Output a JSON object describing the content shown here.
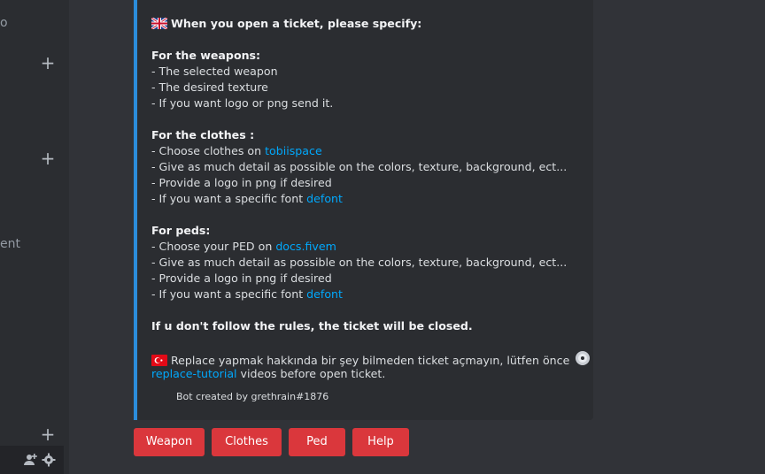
{
  "sidebar": {
    "top_fragment": "o",
    "mid_fragment": "ent"
  },
  "embed": {
    "intro": "When you open a ticket, please specify:",
    "weapons": {
      "heading": "For the weapons:",
      "lines": [
        "- The selected weapon",
        "- The desired texture",
        "- If you want logo or png send it."
      ]
    },
    "clothes": {
      "heading": "For the clothes :",
      "line1_prefix": "- Choose clothes on ",
      "line1_link": "tobiispace",
      "line2": "- Give as much detail as possible on the colors, texture, background, ect...",
      "line3": "- Provide a logo in png if desired",
      "line4_prefix": "- If you want a specific font ",
      "line4_link": "defont"
    },
    "peds": {
      "heading": "For peds:",
      "line1_prefix": "- Choose your PED on ",
      "line1_link": "docs.fivem",
      "line2": "- Give as much detail as possible on the colors, texture, background, ect...",
      "line3": "- Provide a logo in png if desired",
      "line4_prefix": "- If you want a specific font ",
      "line4_link": "defont"
    },
    "warning": "If u don't follow the rules, the ticket will be closed.",
    "turkish_text": "Replace yapmak hakkında bir şey bilmeden ticket açmayın, lütfen önce",
    "turkish_link": "replace-tutorial",
    "turkish_suffix": " videos before open ticket.",
    "footer": "Bot created by grethrain#1876"
  },
  "buttons": [
    {
      "label": "Weapon"
    },
    {
      "label": "Clothes"
    },
    {
      "label": "Ped"
    },
    {
      "label": "Help"
    }
  ],
  "colors": {
    "accent_border": "#2b8ddb",
    "link": "#00a8fc",
    "button_danger": "#da373c"
  },
  "icons": [
    "plus-icon",
    "uk-flag-icon",
    "turkey-flag-icon",
    "cd-icon",
    "add-member-icon",
    "gear-icon"
  ]
}
